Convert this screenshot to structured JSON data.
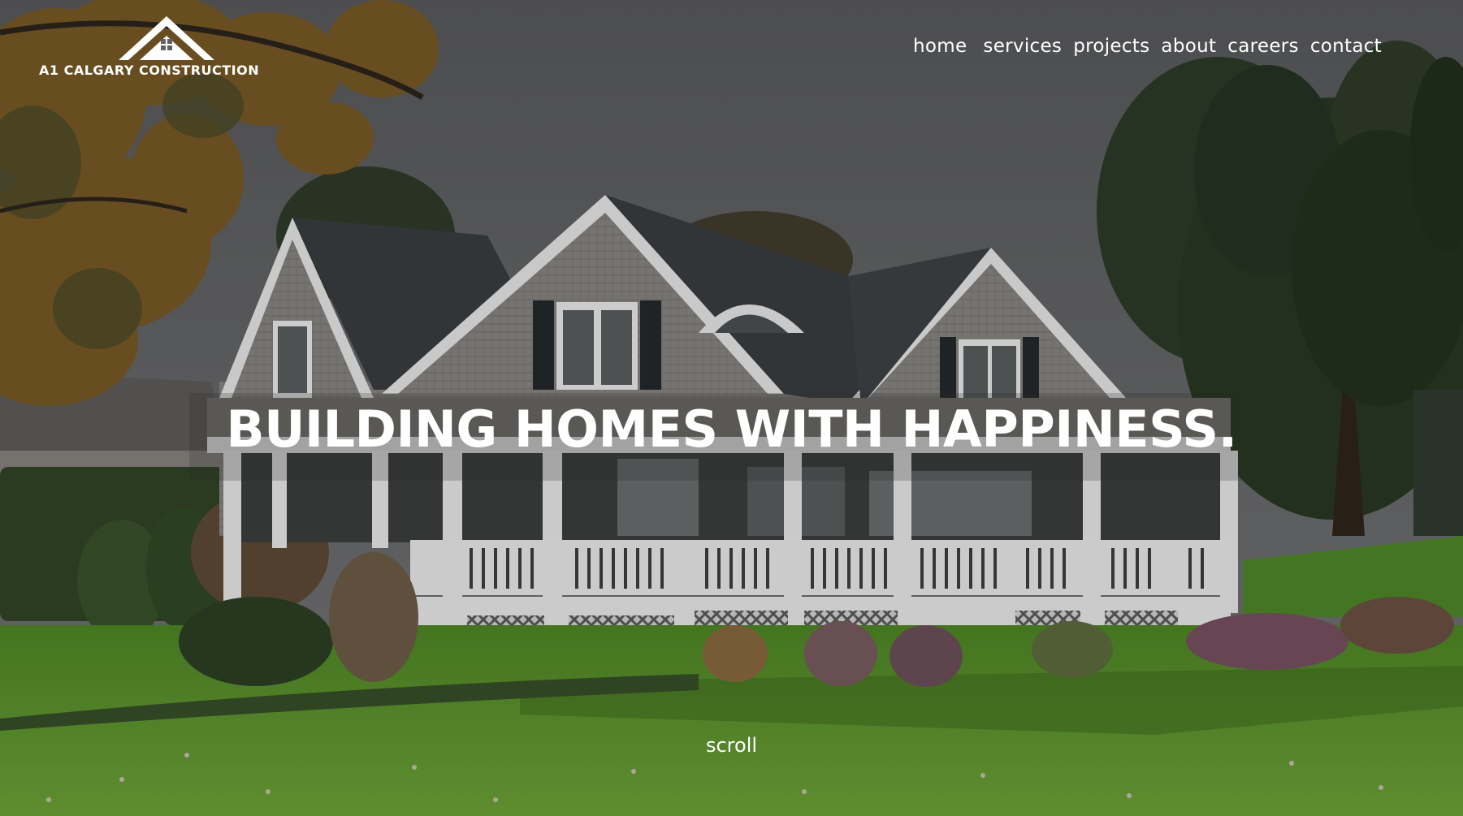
{
  "brand": {
    "name": "A1 CALGARY CONSTRUCTION",
    "logo_icon": "house-roof-icon"
  },
  "nav": {
    "items": [
      {
        "label": "home"
      },
      {
        "label": "services"
      },
      {
        "label": "projects"
      },
      {
        "label": "about"
      },
      {
        "label": "careers"
      },
      {
        "label": "contact"
      }
    ]
  },
  "hero": {
    "headline": "BUILDING HOMES WITH HAPPINESS.",
    "scroll_label": "scroll",
    "background": "house-with-porch-photo"
  },
  "colors": {
    "text": "#ffffff",
    "overlay": "#3a3b3d",
    "lawn": "#5e9a2a",
    "sky": "#6a6b6d"
  }
}
